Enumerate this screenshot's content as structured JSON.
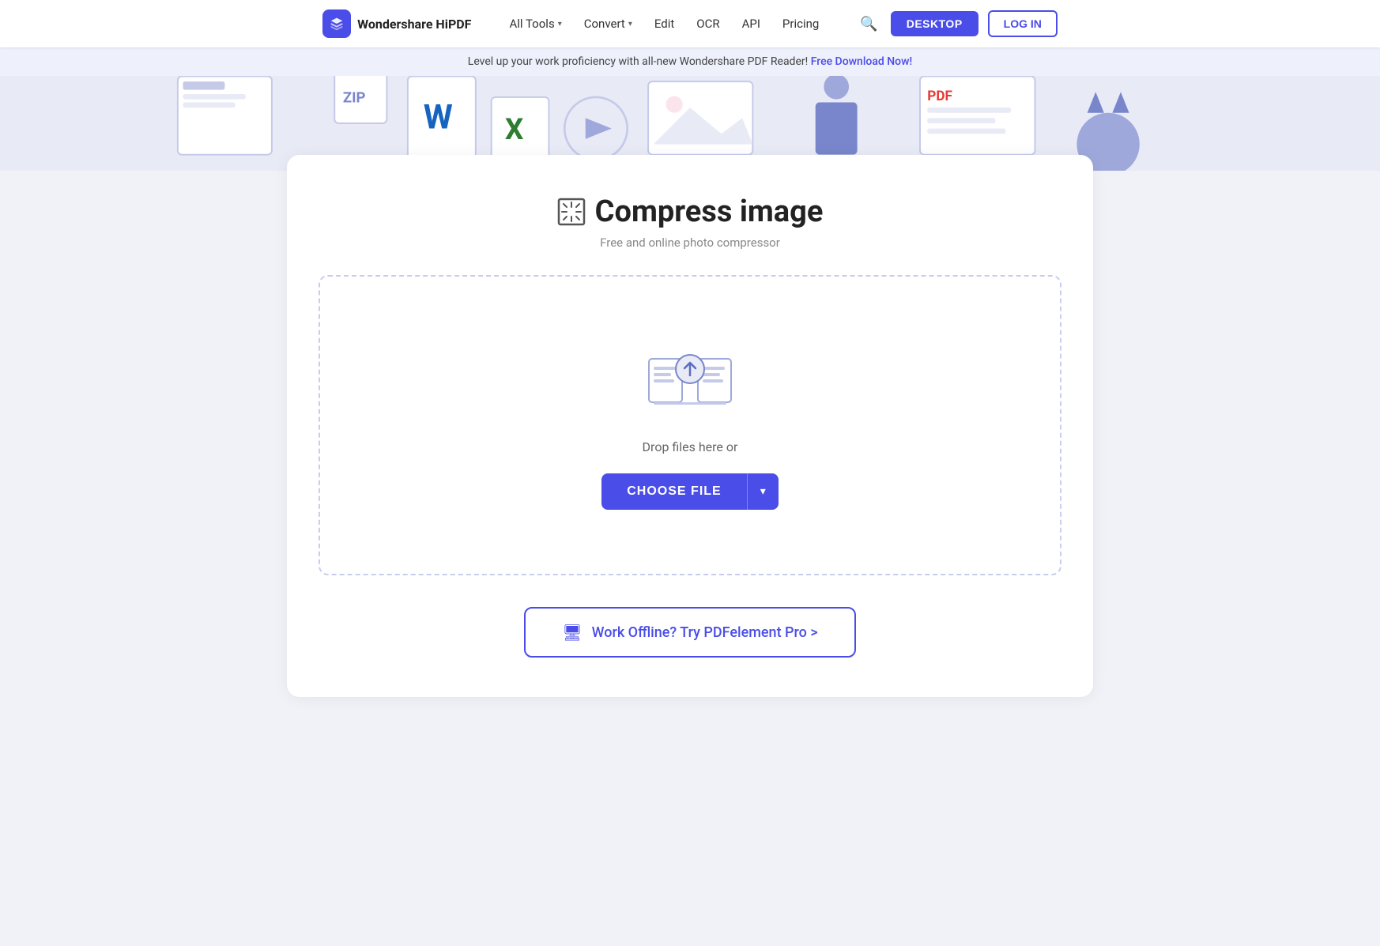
{
  "navbar": {
    "logo_text": "Wondershare HiPDF",
    "nav_items": [
      {
        "label": "All Tools",
        "has_dropdown": true
      },
      {
        "label": "Convert",
        "has_dropdown": true
      },
      {
        "label": "Edit",
        "has_dropdown": false
      },
      {
        "label": "OCR",
        "has_dropdown": false
      },
      {
        "label": "API",
        "has_dropdown": false
      },
      {
        "label": "Pricing",
        "has_dropdown": false
      }
    ],
    "desktop_btn": "DESKTOP",
    "login_btn": "LOG IN"
  },
  "banner": {
    "text": "Level up your work proficiency with all-new Wondershare PDF Reader!",
    "link_text": "Free Download Now!"
  },
  "tool": {
    "title": "Compress image",
    "subtitle": "Free and online photo compressor",
    "drop_text": "Drop files here or",
    "choose_file_btn": "CHOOSE FILE",
    "offline_text": "Work Offline? Try PDFelement Pro >"
  }
}
